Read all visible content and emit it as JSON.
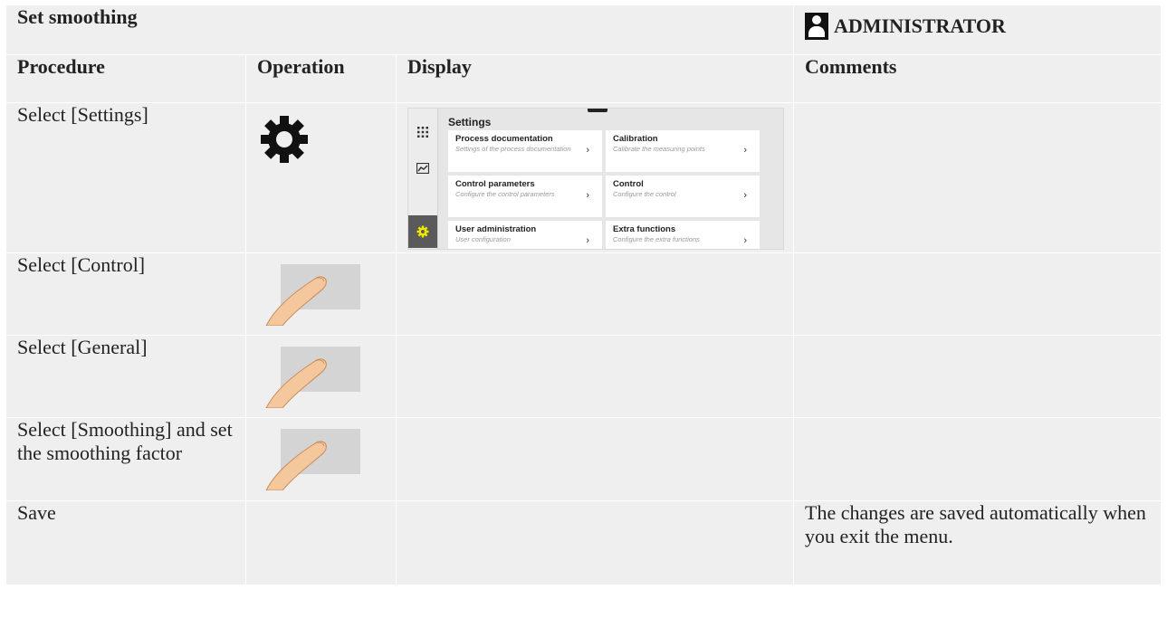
{
  "header": {
    "title": "Set smoothing",
    "role": "ADMINISTRATOR",
    "role_icon": "user-icon"
  },
  "columns": [
    "Procedure",
    "Operation",
    "Display",
    "Comments"
  ],
  "rows": [
    {
      "procedure": "Select [Settings]",
      "operation_icon": "gear-icon",
      "comment": ""
    },
    {
      "procedure": "Select [Control]",
      "operation_icon": "finger-tap-icon",
      "comment": ""
    },
    {
      "procedure": "Select [General]",
      "operation_icon": "finger-tap-icon",
      "comment": ""
    },
    {
      "procedure": "Select [Smoothing] and set the smoothing factor",
      "operation_icon": "finger-tap-icon",
      "comment": ""
    },
    {
      "procedure": "Save",
      "operation_icon": "",
      "comment": "The changes are saved automatically when you exit the menu."
    }
  ],
  "display_screen": {
    "title": "Settings",
    "sidebar_icons": [
      "apps-grid-icon",
      "chart-icon",
      "settings-gear-icon"
    ],
    "tiles": [
      {
        "title": "Process documentation",
        "subtitle": "Settings of the process documentation"
      },
      {
        "title": "Calibration",
        "subtitle": "Calibrate the measuring points"
      },
      {
        "title": "Control parameters",
        "subtitle": "Configure the control parameters"
      },
      {
        "title": "Control",
        "subtitle": "Configure the control"
      },
      {
        "title": "User administration",
        "subtitle": "User configuration"
      },
      {
        "title": "Extra functions",
        "subtitle": "Configure the extra functions"
      }
    ],
    "active_accent": "#f2e600"
  },
  "colors": {
    "header_bg": "#cfcfcf",
    "cell_bg": "#efefef"
  }
}
